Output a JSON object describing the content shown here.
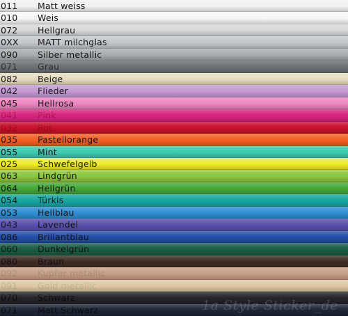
{
  "colors": [
    {
      "code": "011",
      "name": "Matt weiss",
      "bg": "#f2f2f0",
      "text": "#111111"
    },
    {
      "code": "010",
      "name": "Weis",
      "bg": "#f7f7f7",
      "text": "#111111"
    },
    {
      "code": "072",
      "name": "Hellgrau",
      "bg": "#d6d8da",
      "text": "#111111"
    },
    {
      "code": "0XX",
      "name": "MATT milchglas",
      "bg": "#c5c8cb",
      "text": "#111111"
    },
    {
      "code": "090",
      "name": "Silber metallic",
      "bg": "#a9acae",
      "text": "#111111"
    },
    {
      "code": "071",
      "name": "Grau",
      "bg": "#6d7073",
      "text": "#2a2c2e"
    },
    {
      "code": "082",
      "name": "Beige",
      "bg": "#e6dcc0",
      "text": "#111111"
    },
    {
      "code": "042",
      "name": "Flieder",
      "bg": "#c29ad3",
      "text": "#111111"
    },
    {
      "code": "045",
      "name": "Hellrosa",
      "bg": "#ef86c2",
      "text": "#111111"
    },
    {
      "code": "041",
      "name": "Pink",
      "bg": "#d8257c",
      "text": "#b0105a"
    },
    {
      "code": "032",
      "name": "Rot",
      "bg": "#c8102a",
      "text": "#a00a1e"
    },
    {
      "code": "035",
      "name": "Pastellorange",
      "bg": "#f25f23",
      "text": "#111111"
    },
    {
      "code": "055",
      "name": "Mint",
      "bg": "#3ec9b1",
      "text": "#111111"
    },
    {
      "code": "025",
      "name": "Schwefelgelb",
      "bg": "#f1ec26",
      "text": "#111111"
    },
    {
      "code": "063",
      "name": "Lindgrün",
      "bg": "#8cc63e",
      "text": "#111111"
    },
    {
      "code": "064",
      "name": "Hellgrün",
      "bg": "#45a93a",
      "text": "#111111"
    },
    {
      "code": "054",
      "name": "Türkis",
      "bg": "#18a7a3",
      "text": "#111111"
    },
    {
      "code": "053",
      "name": "Hellblau",
      "bg": "#2f8fd4",
      "text": "#111111"
    },
    {
      "code": "043",
      "name": "Lavendel",
      "bg": "#5b50ad",
      "text": "#111111"
    },
    {
      "code": "086",
      "name": "Brillantblau",
      "bg": "#234fa8",
      "text": "#111111"
    },
    {
      "code": "060",
      "name": "Dunkelgrün",
      "bg": "#195d45",
      "text": "#111111"
    },
    {
      "code": "080",
      "name": "Braun",
      "bg": "#3f2d25",
      "text": "#111111"
    },
    {
      "code": "092",
      "name": "Kupfer metallic",
      "bg": "#c69f86",
      "text": "#b08c74"
    },
    {
      "code": "091",
      "name": "Gold metallic",
      "bg": "#ddc9a6",
      "text": "#c7b38f"
    },
    {
      "code": "070",
      "name": "Schwarz",
      "bg": "#23242a",
      "text": "#0a0a0a"
    },
    {
      "code": "071",
      "name": "Matt Schwarz",
      "bg": "#1d2536",
      "text": "#0a0a0a"
    }
  ],
  "watermark": "1a Style Sticker_de"
}
